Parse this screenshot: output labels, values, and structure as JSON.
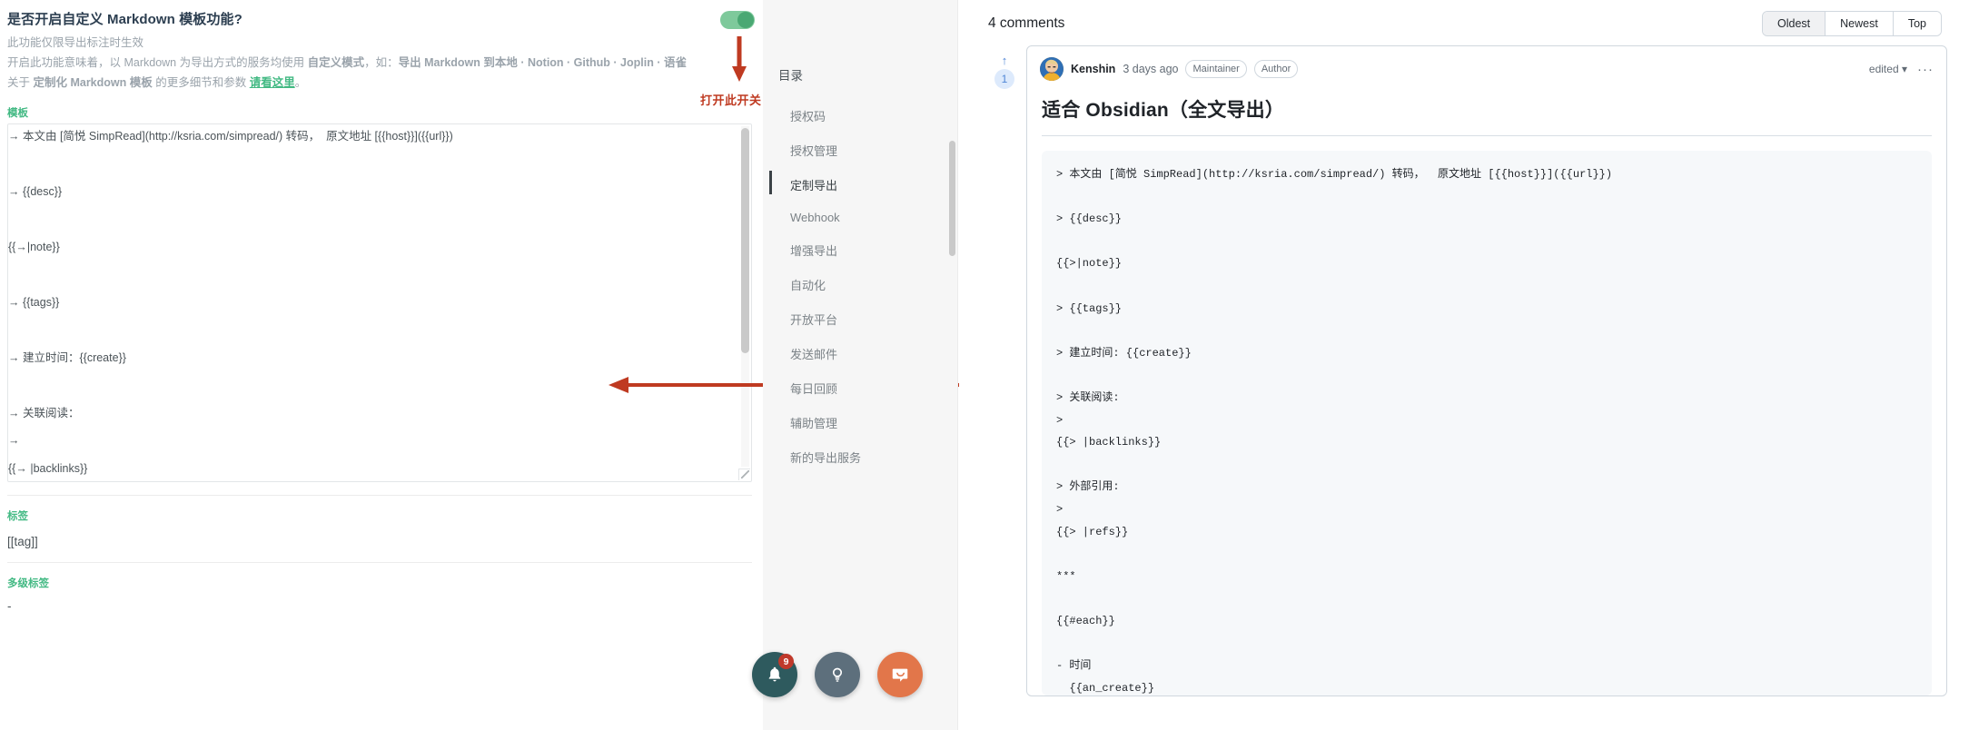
{
  "settings": {
    "option_title": "是否开启自定义 Markdown 模板功能?",
    "option_sub1": "此功能仅限导出标注时生效",
    "option_sub2_a": "开启此功能意味着，以 Markdown 为导出方式的服务均使用 ",
    "option_sub2_b": "自定义模式",
    "option_sub2_c": "，如：",
    "option_sub2_d": "导出 Markdown 到本地 · Notion · Github · Joplin · 语雀",
    "option_sub3_a": "关于 ",
    "option_sub3_b": "定制化 Markdown 模板",
    "option_sub3_c": " 的更多细节和参数 ",
    "option_sub3_link": "请看这里",
    "option_sub3_d": "。",
    "template_label": "模板",
    "template_text": "→ 本文由 [简悦 SimpRead](http://ksria.com/simpread/) 转码，  原文地址 [{{host}}]({{url}})\n\n→ {{desc}}\n\n{{→|note}}\n\n→ {{tags}}\n\n→ 建立时间：{{create}}\n\n→ 关联阅读：\n→\n{{→ |backlinks}}\n\n→ 外部引用：\n→\n{{→ |refs}}\n\n***\n\n{{#each}}\n\n- 时间\n  {{an_create}}\n\n  (=)",
    "tag_label": "标签",
    "tag_value": "[[tag]]",
    "multitag_label": "多级标签",
    "multitag_value": "-",
    "toggle_state": "on",
    "annotation_text": "打开此开关",
    "annotation_color": "#bf3a21"
  },
  "toc": {
    "title": "目录",
    "items": [
      {
        "label": "授权码",
        "active": false
      },
      {
        "label": "授权管理",
        "active": false
      },
      {
        "label": "定制导出",
        "active": true
      },
      {
        "label": "Webhook",
        "active": false
      },
      {
        "label": "增强导出",
        "active": false
      },
      {
        "label": "自动化",
        "active": false
      },
      {
        "label": "开放平台",
        "active": false
      },
      {
        "label": "发送邮件",
        "active": false
      },
      {
        "label": "每日回顾",
        "active": false
      },
      {
        "label": "辅助管理",
        "active": false
      },
      {
        "label": "新的导出服务",
        "active": false
      }
    ]
  },
  "fabs": {
    "bell_badge": "9",
    "bell_color": "#2e5a5e",
    "bulb_color": "#5d6f7c",
    "chat_color": "#e2764a"
  },
  "comments": {
    "count_label": "4 comments",
    "sort": {
      "options": [
        "Oldest",
        "Newest",
        "Top"
      ],
      "selected": "Oldest"
    },
    "items": [
      {
        "vote_count": "1",
        "author": "Kenshin",
        "time": "3 days ago",
        "badges": [
          "Maintainer",
          "Author"
        ],
        "edited_label": "edited",
        "menu_glyph": "···",
        "title": "适合 Obsidian（全文导出）",
        "code": "> 本文由 [简悦 SimpRead](http://ksria.com/simpread/) 转码，  原文地址 [{{host}}]({{url}})\n\n> {{desc}}\n\n{{>|note}}\n\n> {{tags}}\n\n> 建立时间: {{create}}\n\n> 关联阅读:\n>\n{{> |backlinks}}\n\n> 外部引用:\n>\n{{> |refs}}\n\n***\n\n{{#each}}\n\n- 时间\n  {{an_create}}\n\n- 标注\n{{  >|an_html}}\n\n- 备注\n{{  >|an_note}}\n\n- 标签\n  {{an_tags}}\n\n- 关联\n{{  |an_backlinks}}"
      }
    ]
  }
}
